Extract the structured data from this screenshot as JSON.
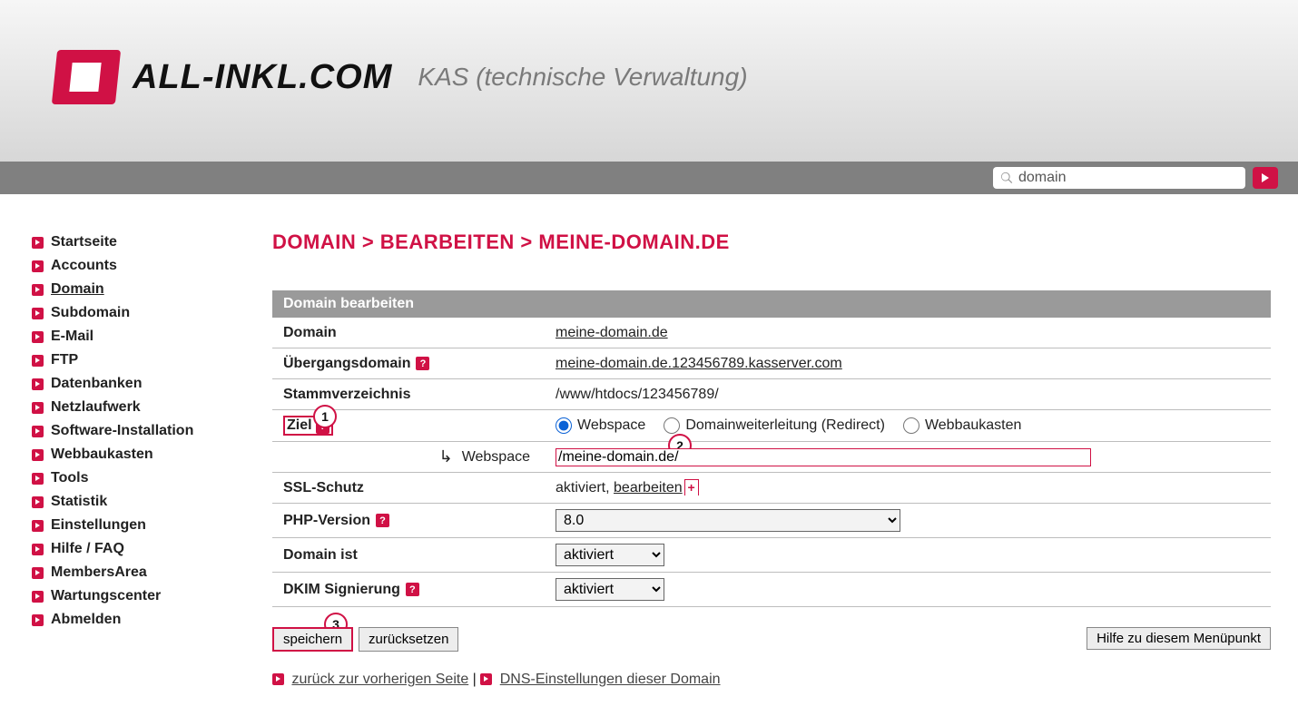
{
  "header": {
    "brand": "ALL-INKL.COM",
    "subtitle": "KAS (technische Verwaltung)"
  },
  "search": {
    "value": "domain",
    "placeholder": ""
  },
  "sidebar": {
    "items": [
      {
        "label": "Startseite"
      },
      {
        "label": "Accounts"
      },
      {
        "label": "Domain",
        "active": true
      },
      {
        "label": "Subdomain"
      },
      {
        "label": "E-Mail"
      },
      {
        "label": "FTP"
      },
      {
        "label": "Datenbanken"
      },
      {
        "label": "Netzlaufwerk"
      },
      {
        "label": "Software-Installation"
      },
      {
        "label": "Webbaukasten"
      },
      {
        "label": "Tools"
      },
      {
        "label": "Statistik"
      },
      {
        "label": "Einstellungen"
      },
      {
        "label": "Hilfe / FAQ"
      },
      {
        "label": "MembersArea"
      },
      {
        "label": "Wartungscenter"
      },
      {
        "label": "Abmelden"
      }
    ]
  },
  "breadcrumb": "DOMAIN > BEARBEITEN > MEINE-DOMAIN.DE",
  "panel": {
    "title": "Domain bearbeiten",
    "domain_label": "Domain",
    "domain_value": "meine-domain.de",
    "trans_label": "Übergangsdomain",
    "trans_value": "meine-domain.de.123456789.kasserver.com",
    "root_label": "Stammverzeichnis",
    "root_value": "/www/htdocs/123456789/",
    "target_label": "Ziel",
    "target_opts": {
      "webspace": "Webspace",
      "redirect": "Domainweiterleitung (Redirect)",
      "builder": "Webbaukasten"
    },
    "target_selected": "webspace",
    "webspace_sublabel": "Webspace",
    "webspace_value": "/meine-domain.de/",
    "ssl_label": "SSL-Schutz",
    "ssl_value_status": "aktiviert",
    "ssl_value_edit": "bearbeiten",
    "php_label": "PHP-Version",
    "php_value": "8.0",
    "active_label": "Domain ist",
    "active_value": "aktiviert",
    "dkim_label": "DKIM Signierung",
    "dkim_value": "aktiviert"
  },
  "buttons": {
    "save": "speichern",
    "reset": "zurücksetzen",
    "help": "Hilfe zu diesem Menüpunkt"
  },
  "links": {
    "back": "zurück zur vorherigen Seite",
    "dns": "DNS-Einstellungen dieser Domain"
  },
  "annotations": {
    "marker1": "1",
    "marker2": "2",
    "marker3": "3"
  }
}
